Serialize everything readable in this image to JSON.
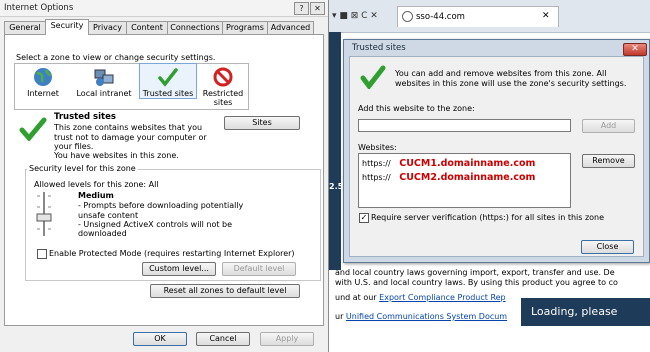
{
  "io": {
    "title": "Internet Options",
    "help_btn": "?",
    "close_btn": "✕",
    "tabs": [
      "General",
      "Security",
      "Privacy",
      "Content",
      "Connections",
      "Programs",
      "Advanced"
    ],
    "select_zone_text": "Select a zone to view or change security settings.",
    "zones": [
      "Internet",
      "Local intranet",
      "Trusted sites",
      "Restricted sites"
    ],
    "zone_heading": "Trusted sites",
    "zone_desc": "This zone contains websites that you trust not to damage your computer or your files.",
    "zone_desc2": "You have websites in this zone.",
    "sites_btn": "Sites",
    "security_level_legend": "Security level for this zone",
    "allowed_levels": "Allowed levels for this zone: All",
    "level_name": "Medium",
    "level_bullet1": "- Prompts before downloading potentially unsafe content",
    "level_bullet2": "- Unsigned ActiveX controls will not be downloaded",
    "protected_mode": "Enable Protected Mode (requires restarting Internet Explorer)",
    "custom_level_btn": "Custom level...",
    "default_level_btn": "Default level",
    "reset_all_btn": "Reset all zones to default level",
    "ok_btn": "OK",
    "cancel_btn": "Cancel",
    "apply_btn": "Apply"
  },
  "browser": {
    "nav_icons": "▾ ■ ⊠ C ✕",
    "tab_title": "sso-44.com",
    "tab_close": "✕",
    "side_text": "2.5",
    "line1": "and local country laws governing import, export, transfer and use. De",
    "line2": "with U.S. and local country laws. By using this product you agree to co",
    "line3_prefix": "und at our",
    "line3_link": "Export Compliance Product Rep",
    "line4_prefix": "ur",
    "line4_link": "Unified Communications System Docum",
    "loading_text": "Loading, please"
  },
  "trusted": {
    "title": "Trusted sites",
    "close_btn": "✕",
    "info_text": "You can add and remove websites from this zone. All websites in this zone will use the zone's security settings.",
    "add_label": "Add this website to the zone:",
    "add_value": "",
    "add_btn": "Add",
    "websites_label": "Websites:",
    "sites": [
      {
        "scheme": "https://",
        "host": "CUCM1.domainname.com"
      },
      {
        "scheme": "https://",
        "host": "CUCM2.domainname.com"
      }
    ],
    "remove_btn": "Remove",
    "require_https": "Require server verification (https:) for all sites in this zone",
    "close_btn_label": "Close"
  },
  "colors": {
    "check_green": "#2fa02f",
    "restricted_red": "#d42020",
    "url_red": "#cc0000",
    "loading_bg": "#1e3b5a"
  }
}
